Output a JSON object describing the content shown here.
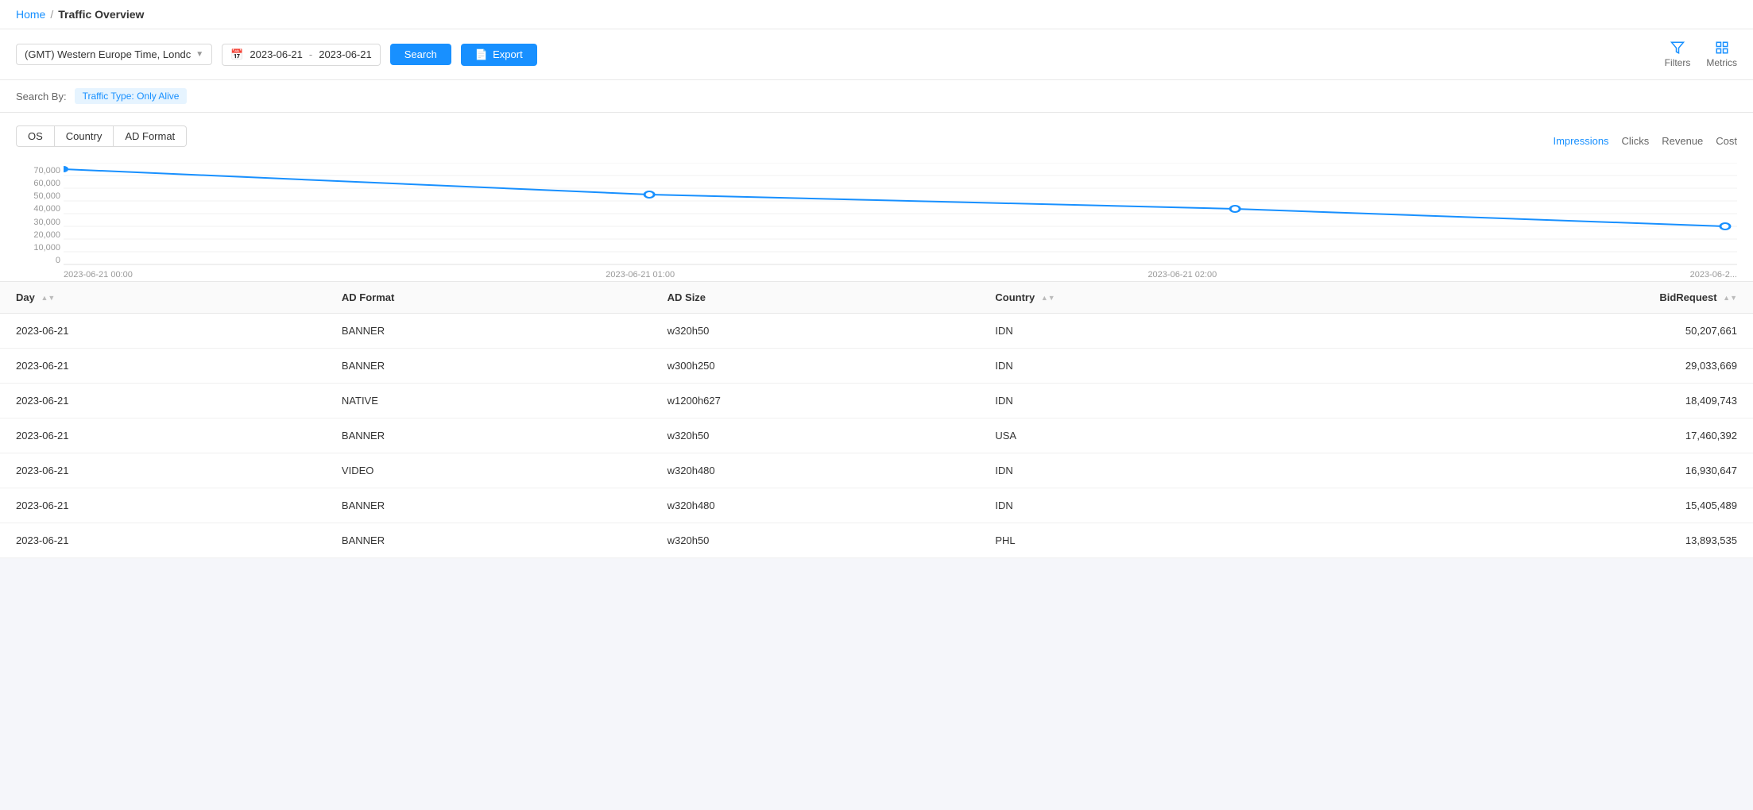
{
  "breadcrumb": {
    "home": "Home",
    "separator": "/",
    "current": "Traffic Overview"
  },
  "toolbar": {
    "timezone": "(GMT) Western Europe Time, Londc",
    "date_from": "2023-06-21",
    "date_to": "2023-06-21",
    "search_label": "Search",
    "export_label": "Export",
    "filters_label": "Filters",
    "metrics_label": "Metrics"
  },
  "filter_bar": {
    "label": "Search By:",
    "tag": "Traffic Type: Only Alive"
  },
  "chart": {
    "tabs": [
      {
        "id": "os",
        "label": "OS"
      },
      {
        "id": "country",
        "label": "Country"
      },
      {
        "id": "ad_format",
        "label": "AD Format"
      }
    ],
    "metrics": [
      {
        "id": "impressions",
        "label": "Impressions",
        "active": true
      },
      {
        "id": "clicks",
        "label": "Clicks",
        "active": false
      },
      {
        "id": "revenue",
        "label": "Revenue",
        "active": false
      },
      {
        "id": "cost",
        "label": "Cost",
        "active": false
      }
    ],
    "y_labels": [
      "70,000",
      "60,000",
      "50,000",
      "40,000",
      "30,000",
      "20,000",
      "10,000",
      "0"
    ],
    "x_labels": [
      "2023-06-21 00:00",
      "2023-06-21 01:00",
      "2023-06-21 02:00",
      "2023-06-2..."
    ]
  },
  "table": {
    "columns": [
      {
        "id": "day",
        "label": "Day",
        "sortable": true
      },
      {
        "id": "ad_format",
        "label": "AD Format",
        "sortable": false
      },
      {
        "id": "ad_size",
        "label": "AD Size",
        "sortable": false
      },
      {
        "id": "country",
        "label": "Country",
        "sortable": true
      },
      {
        "id": "bidrequests",
        "label": "BidRequest",
        "sortable": true,
        "align": "right"
      }
    ],
    "rows": [
      {
        "day": "2023-06-21",
        "ad_format": "BANNER",
        "ad_size": "w320h50",
        "country": "IDN",
        "bidrequests": "50,207,661"
      },
      {
        "day": "2023-06-21",
        "ad_format": "BANNER",
        "ad_size": "w300h250",
        "country": "IDN",
        "bidrequests": "29,033,669"
      },
      {
        "day": "2023-06-21",
        "ad_format": "NATIVE",
        "ad_size": "w1200h627",
        "country": "IDN",
        "bidrequests": "18,409,743"
      },
      {
        "day": "2023-06-21",
        "ad_format": "BANNER",
        "ad_size": "w320h50",
        "country": "USA",
        "bidrequests": "17,460,392"
      },
      {
        "day": "2023-06-21",
        "ad_format": "VIDEO",
        "ad_size": "w320h480",
        "country": "IDN",
        "bidrequests": "16,930,647"
      },
      {
        "day": "2023-06-21",
        "ad_format": "BANNER",
        "ad_size": "w320h480",
        "country": "IDN",
        "bidrequests": "15,405,489"
      },
      {
        "day": "2023-06-21",
        "ad_format": "BANNER",
        "ad_size": "w320h50",
        "country": "PHL",
        "bidrequests": "13,893,535"
      }
    ]
  }
}
